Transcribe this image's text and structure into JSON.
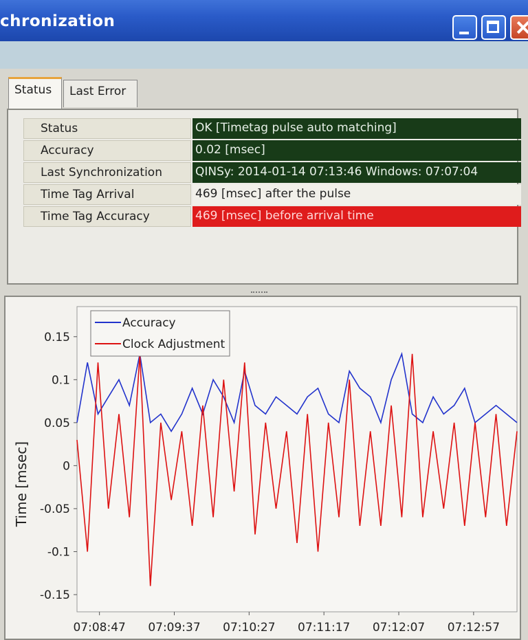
{
  "window": {
    "title": "chronization"
  },
  "tabs": [
    {
      "label": "Status",
      "active": true
    },
    {
      "label": "Last Error",
      "active": false
    }
  ],
  "status_rows": [
    {
      "label": "Status",
      "value": "OK [Timetag pulse auto matching]",
      "state": "ok"
    },
    {
      "label": "Accuracy",
      "value": "0.02 [msec]",
      "state": "ok"
    },
    {
      "label": "Last Synchronization",
      "value": "QINSy: 2014-01-14 07:13:46 Windows: 07:07:04",
      "state": "ok"
    },
    {
      "label": "Time Tag Arrival",
      "value": "469 [msec] after the pulse",
      "state": "neutral"
    },
    {
      "label": "Time Tag Accuracy",
      "value": "469 [msec] before arrival time",
      "state": "error"
    }
  ],
  "colors": {
    "ok": "#183b18",
    "error": "#df1c1c",
    "accuracy_series": "#2233cc",
    "clock_series": "#dd1111"
  },
  "chart_data": {
    "type": "line",
    "ylabel": "Time [msec]",
    "ylim": [
      -0.17,
      0.185
    ],
    "yticks": [
      0.15,
      0.1,
      0.05,
      0,
      -0.05,
      -0.1,
      -0.15
    ],
    "ytick_labels": [
      "0.15",
      "0.1",
      "0.05",
      "0",
      "-0.05",
      "-0.1",
      "-0.15"
    ],
    "xlim": [
      "07:08:32",
      "07:13:26"
    ],
    "xtick_labels": [
      "07:08:47",
      "07:09:37",
      "07:10:27",
      "07:11:17",
      "07:12:07",
      "07:12:57"
    ],
    "legend": {
      "placement": "top-left",
      "entries": [
        "Accuracy",
        "Clock Adjustment"
      ]
    },
    "grid": false,
    "series": [
      {
        "name": "Accuracy",
        "color": "#2233cc",
        "x": [
          "07:08:32",
          "07:08:39",
          "07:08:46",
          "07:08:53",
          "07:09:00",
          "07:09:07",
          "07:09:14",
          "07:09:21",
          "07:09:28",
          "07:09:35",
          "07:09:42",
          "07:09:49",
          "07:09:56",
          "07:10:03",
          "07:10:10",
          "07:10:17",
          "07:10:24",
          "07:10:31",
          "07:10:38",
          "07:10:45",
          "07:10:52",
          "07:10:59",
          "07:11:06",
          "07:11:13",
          "07:11:20",
          "07:11:27",
          "07:11:34",
          "07:11:41",
          "07:11:48",
          "07:11:55",
          "07:12:02",
          "07:12:09",
          "07:12:16",
          "07:12:23",
          "07:12:30",
          "07:12:37",
          "07:12:44",
          "07:12:51",
          "07:12:58",
          "07:13:05",
          "07:13:12",
          "07:13:19",
          "07:13:26"
        ],
        "values": [
          0.05,
          0.12,
          0.06,
          0.08,
          0.1,
          0.07,
          0.13,
          0.05,
          0.06,
          0.04,
          0.06,
          0.09,
          0.06,
          0.1,
          0.08,
          0.05,
          0.11,
          0.07,
          0.06,
          0.08,
          0.07,
          0.06,
          0.08,
          0.09,
          0.06,
          0.05,
          0.11,
          0.09,
          0.08,
          0.05,
          0.1,
          0.13,
          0.06,
          0.05,
          0.08,
          0.06,
          0.07,
          0.09,
          0.05,
          0.06,
          0.07,
          0.06,
          0.05
        ]
      },
      {
        "name": "Clock Adjustment",
        "color": "#dd1111",
        "x": [
          "07:08:32",
          "07:08:39",
          "07:08:46",
          "07:08:53",
          "07:09:00",
          "07:09:07",
          "07:09:14",
          "07:09:21",
          "07:09:28",
          "07:09:35",
          "07:09:42",
          "07:09:49",
          "07:09:56",
          "07:10:03",
          "07:10:10",
          "07:10:17",
          "07:10:24",
          "07:10:31",
          "07:10:38",
          "07:10:45",
          "07:10:52",
          "07:10:59",
          "07:11:06",
          "07:11:13",
          "07:11:20",
          "07:11:27",
          "07:11:34",
          "07:11:41",
          "07:11:48",
          "07:11:55",
          "07:12:02",
          "07:12:09",
          "07:12:16",
          "07:12:23",
          "07:12:30",
          "07:12:37",
          "07:12:44",
          "07:12:51",
          "07:12:58",
          "07:13:05",
          "07:13:12",
          "07:13:19",
          "07:13:26"
        ],
        "values": [
          0.03,
          -0.1,
          0.12,
          -0.05,
          0.06,
          -0.06,
          0.13,
          -0.14,
          0.05,
          -0.04,
          0.04,
          -0.07,
          0.07,
          -0.06,
          0.1,
          -0.03,
          0.12,
          -0.08,
          0.05,
          -0.05,
          0.04,
          -0.09,
          0.06,
          -0.1,
          0.05,
          -0.06,
          0.1,
          -0.07,
          0.04,
          -0.07,
          0.07,
          -0.06,
          0.13,
          -0.06,
          0.04,
          -0.05,
          0.05,
          -0.07,
          0.05,
          -0.06,
          0.06,
          -0.07,
          0.04
        ]
      }
    ]
  }
}
